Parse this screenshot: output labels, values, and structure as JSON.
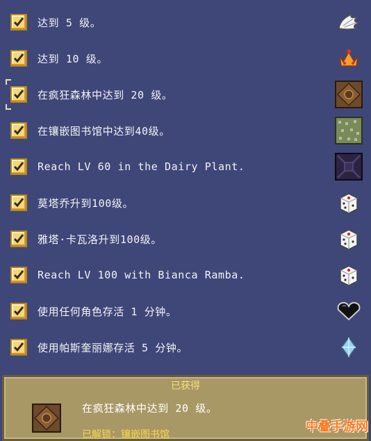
{
  "achievements": [
    {
      "label": "达到 5 级。",
      "icon": "wings-icon",
      "checked": true
    },
    {
      "label": "达到 10 级。",
      "icon": "crown-icon",
      "checked": true
    },
    {
      "label": "在疯狂森林中达到 20 级。",
      "icon": "tile-brown-icon",
      "checked": true,
      "selected": true
    },
    {
      "label": "在镶嵌图书馆中达到40级。",
      "icon": "tile-green-icon",
      "checked": true
    },
    {
      "label": "Reach LV 60 in the Dairy Plant.",
      "icon": "tile-dark-icon",
      "checked": true
    },
    {
      "label": "莫塔乔升到100级。",
      "icon": "dice-icon",
      "checked": true
    },
    {
      "label": "雅塔·卡瓦洛升到100级。",
      "icon": "dice-icon",
      "checked": true
    },
    {
      "label": "Reach LV 100 with Bianca Ramba.",
      "icon": "dice-icon",
      "checked": true
    },
    {
      "label": "使用任何角色存活 1 分钟。",
      "icon": "heart-icon",
      "checked": true
    },
    {
      "label": "使用帕斯奎丽娜存活 5 分钟。",
      "icon": "diamond-icon",
      "checked": true
    }
  ],
  "detail": {
    "header": "已获得",
    "text": "在疯狂森林中达到 20 级。",
    "unlock": "已解锁：镶嵌图书馆",
    "icon": "tile-brown-icon"
  },
  "watermark": "中叠手游网",
  "colors": {
    "background": "#3f4779",
    "panel": "#a89866",
    "check": "#f4d67c",
    "unlock": "#f6d84a"
  }
}
